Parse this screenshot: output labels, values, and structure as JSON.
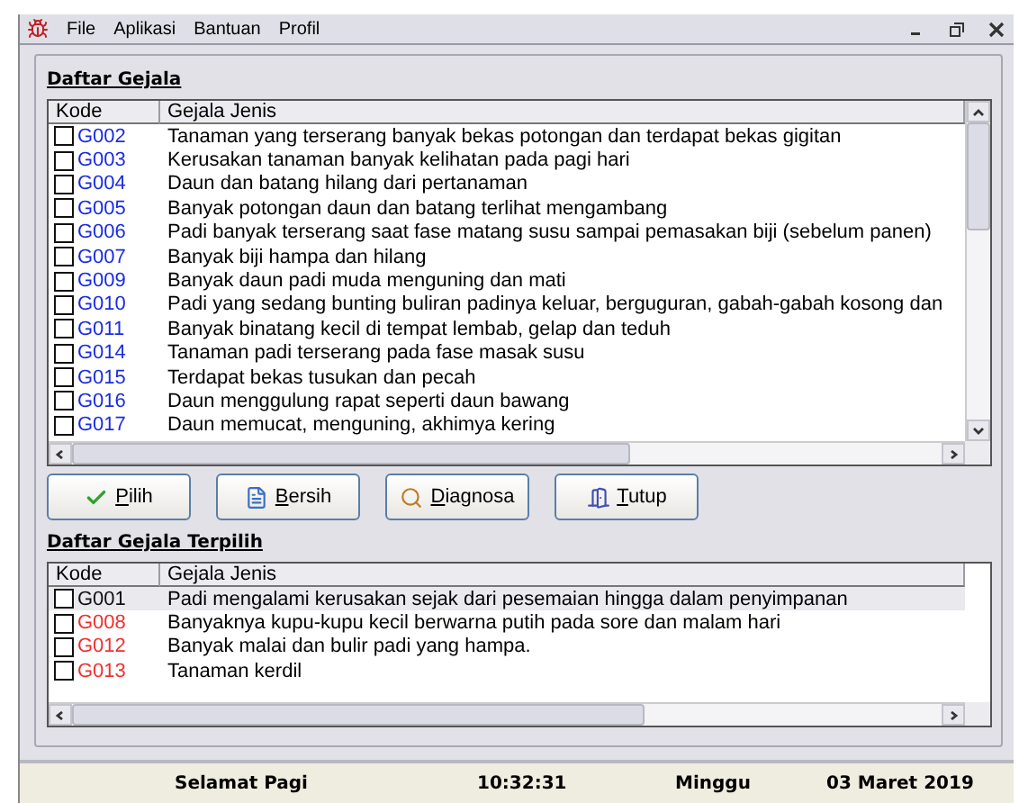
{
  "menu": [
    "File",
    "Aplikasi",
    "Bantuan",
    "Profil"
  ],
  "symptoms": {
    "title": "Daftar Gejala",
    "columns": [
      "Kode",
      "Gejala Jenis"
    ],
    "rows": [
      {
        "code": "G002",
        "text": "Tanaman yang terserang banyak bekas potongan dan terdapat bekas gigitan",
        "checked": false,
        "selected": false
      },
      {
        "code": "G003",
        "text": "Kerusakan tanaman banyak kelihatan pada pagi hari",
        "checked": false,
        "selected": false
      },
      {
        "code": "G004",
        "text": "Daun dan batang hilang dari pertanaman",
        "checked": false,
        "selected": false
      },
      {
        "code": "G005",
        "text": "Banyak potongan daun dan batang terlihat mengambang",
        "checked": false,
        "selected": false
      },
      {
        "code": "G006",
        "text": "Padi banyak terserang saat fase matang susu sampai pemasakan biji (sebelum panen)",
        "checked": false,
        "selected": false
      },
      {
        "code": "G007",
        "text": "Banyak biji hampa dan hilang",
        "checked": false,
        "selected": false
      },
      {
        "code": "G009",
        "text": "Banyak daun padi muda menguning dan mati",
        "checked": false,
        "selected": false
      },
      {
        "code": "G010",
        "text": "Padi yang sedang bunting buliran padinya keluar, berguguran, gabah-gabah kosong dan",
        "checked": false,
        "selected": false
      },
      {
        "code": "G011",
        "text": "Banyak binatang kecil di tempat lembab, gelap dan teduh",
        "checked": false,
        "selected": false
      },
      {
        "code": "G014",
        "text": "Tanaman padi terserang pada fase masak susu",
        "checked": false,
        "selected": false
      },
      {
        "code": "G015",
        "text": "Terdapat bekas tusukan dan pecah",
        "checked": false,
        "selected": false
      },
      {
        "code": "G016",
        "text": "Daun menggulung rapat seperti daun bawang",
        "checked": false,
        "selected": false
      },
      {
        "code": "G017",
        "text": "Daun memucat, menguning, akhimya kering",
        "checked": false,
        "selected": false
      }
    ]
  },
  "buttons": [
    {
      "label": "Pilih",
      "kind": "check"
    },
    {
      "label": "Bersih",
      "kind": "document"
    },
    {
      "label": "Diagnosa",
      "kind": "search"
    },
    {
      "label": "Tutup",
      "kind": "door"
    }
  ],
  "chosen": {
    "title": "Daftar Gejala Terpilih",
    "columns": [
      "Kode",
      "Gejala Jenis"
    ],
    "rows": [
      {
        "code": "G001",
        "text": "Padi mengalami kerusakan sejak dari pesemaian hingga dalam penyimpanan",
        "checked": false,
        "selected": true
      },
      {
        "code": "G008",
        "text": "Banyaknya kupu-kupu kecil berwarna putih pada sore dan malam hari",
        "checked": false,
        "selected": false
      },
      {
        "code": "G012",
        "text": "Banyak malai dan bulir padi yang hampa.",
        "checked": false,
        "selected": false
      },
      {
        "code": "G013",
        "text": "Tanaman kerdil",
        "checked": false,
        "selected": false
      }
    ]
  },
  "status_bar": {
    "greeting": "Selamat Pagi",
    "time": "10:32:31",
    "day": "Minggu",
    "date": "03 Maret 2019"
  }
}
